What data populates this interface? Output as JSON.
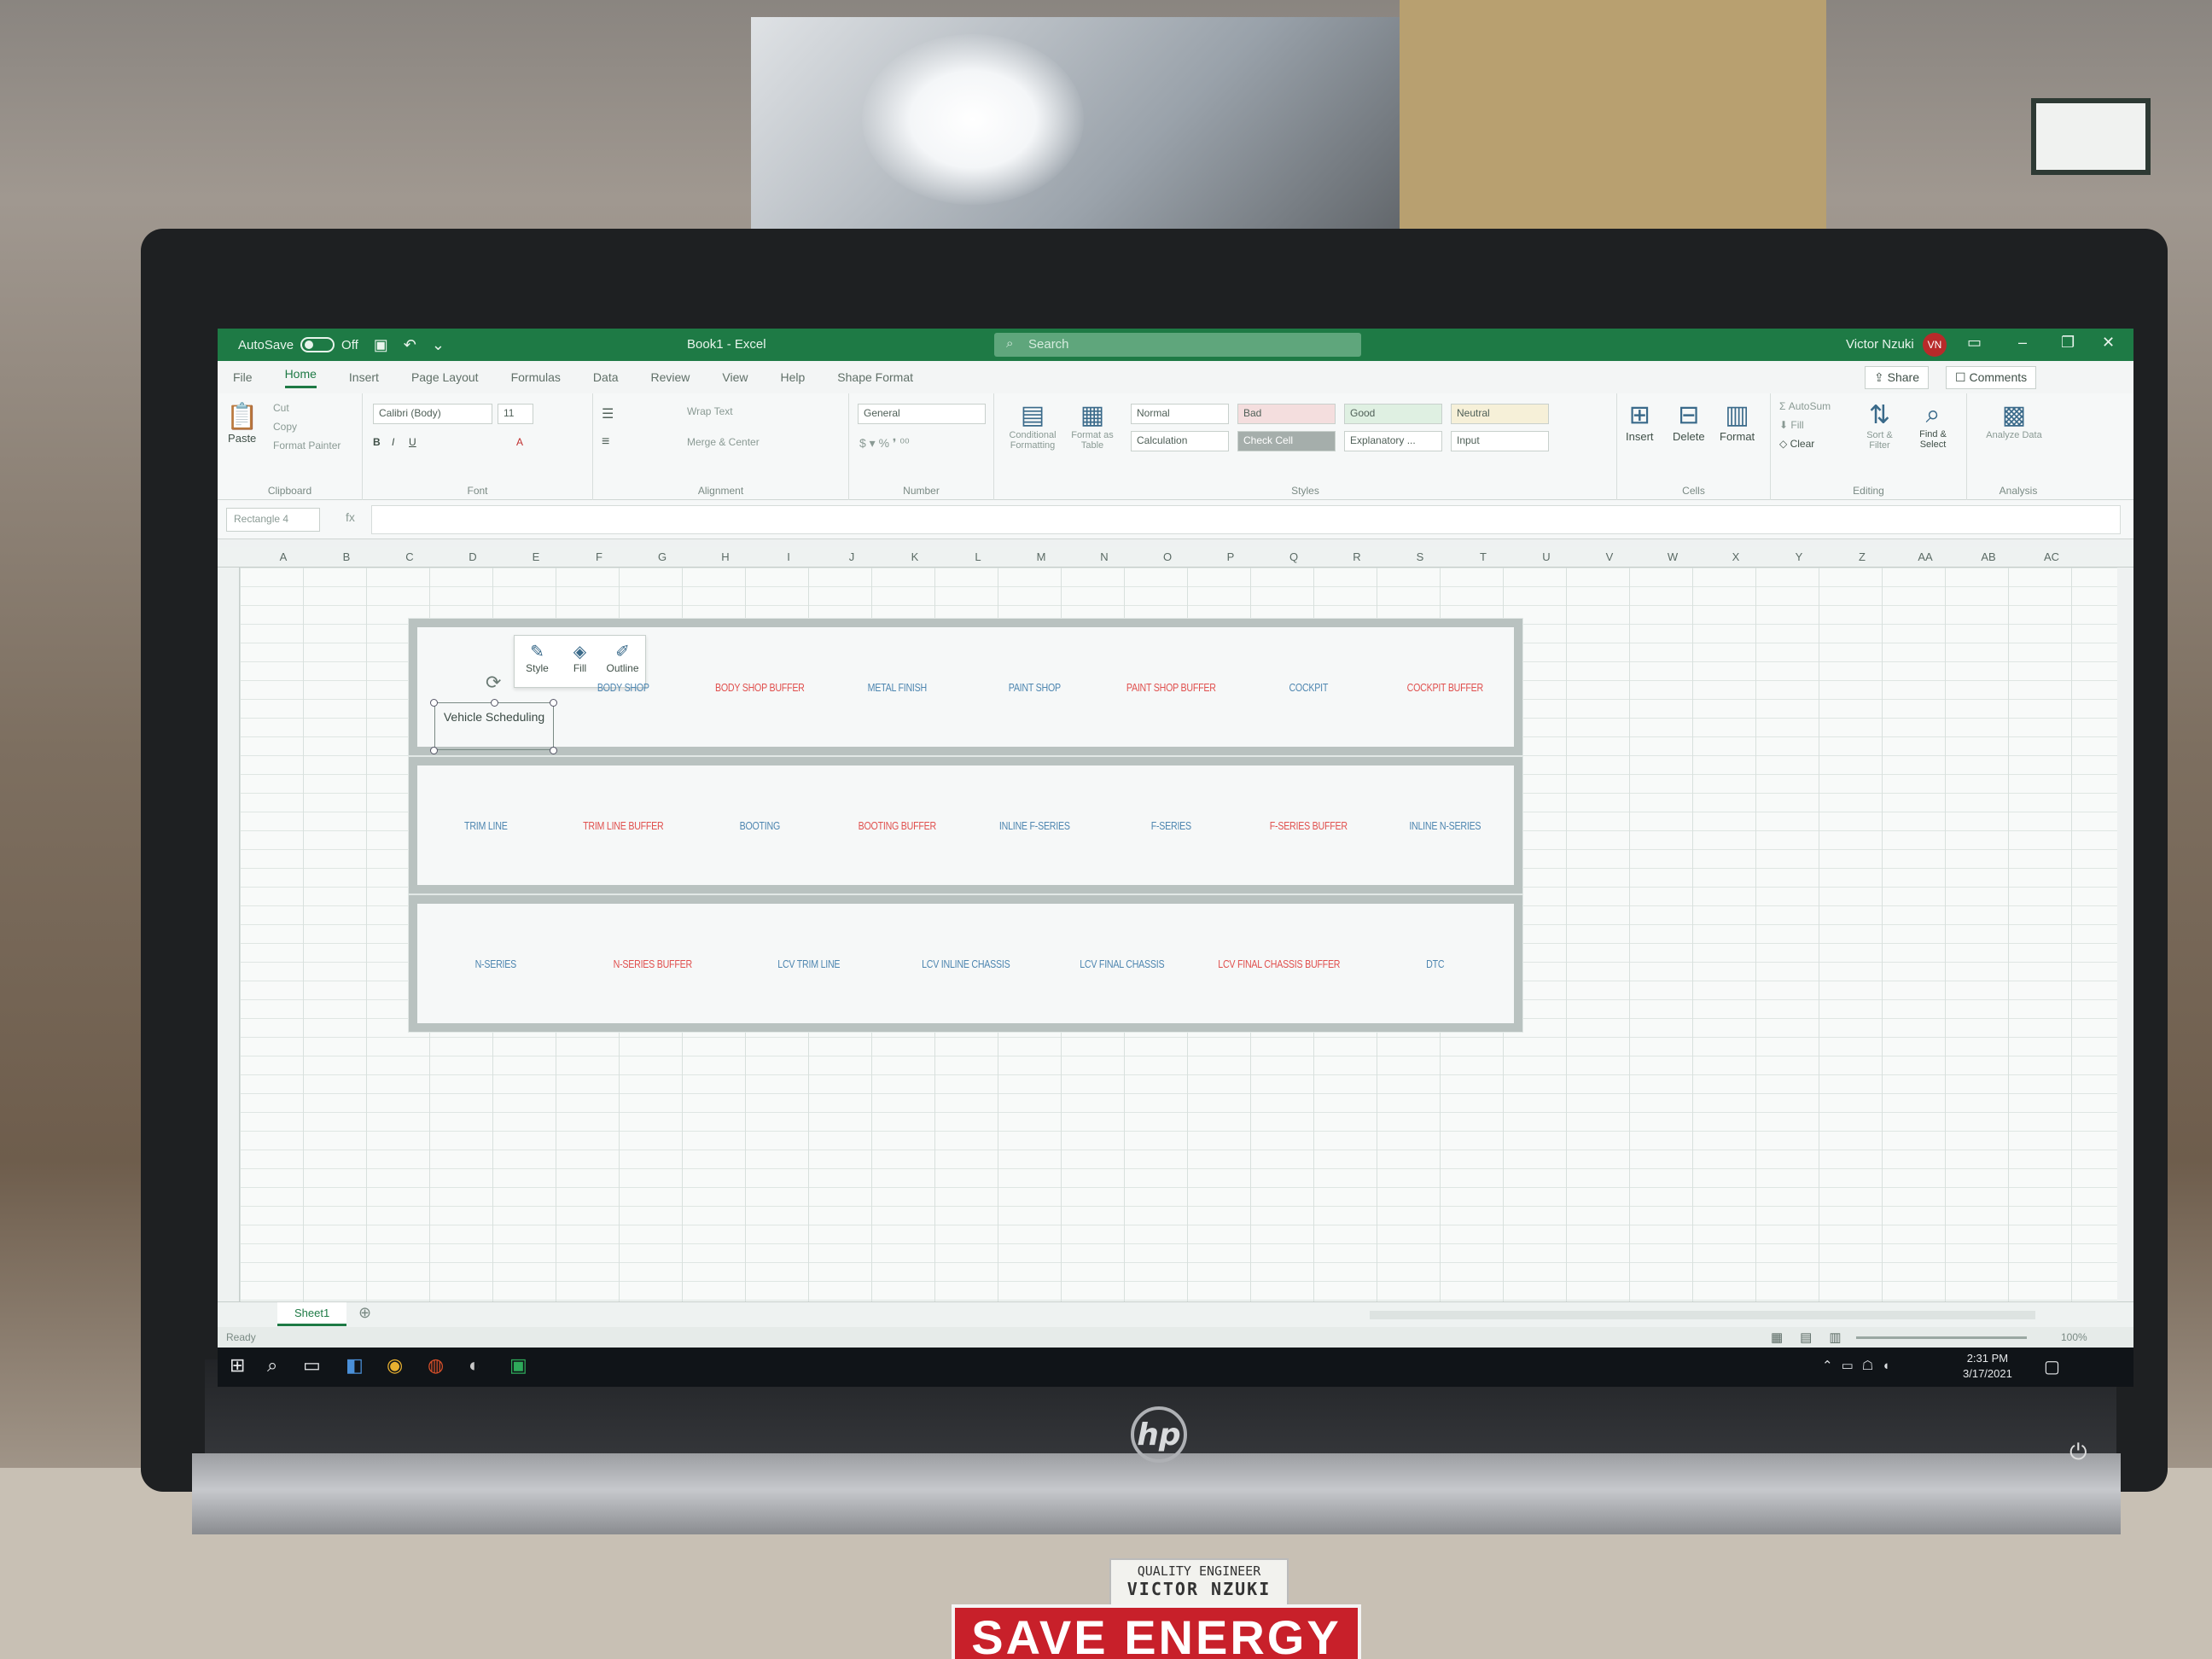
{
  "window": {
    "autosave_label": "AutoSave",
    "autosave_state": "Off",
    "title": "Book1 - Excel",
    "search_placeholder": "Search",
    "user_name": "Victor Nzuki",
    "user_initials": "VN"
  },
  "menu_tabs": [
    "File",
    "Home",
    "Insert",
    "Page Layout",
    "Formulas",
    "Data",
    "Review",
    "View",
    "Help",
    "Shape Format"
  ],
  "active_tab": "Home",
  "share_label": "Share",
  "comments_label": "Comments",
  "ribbon": {
    "clipboard": {
      "paste": "Paste",
      "cut": "Cut",
      "copy": "Copy",
      "format_painter": "Format Painter",
      "label": "Clipboard"
    },
    "font": {
      "font_name": "Calibri (Body)",
      "font_size": "11",
      "label": "Font"
    },
    "alignment": {
      "wrap": "Wrap Text",
      "merge": "Merge & Center",
      "label": "Alignment"
    },
    "number": {
      "format": "General",
      "label": "Number"
    },
    "styles": {
      "conditional": "Conditional Formatting",
      "format_table": "Format as Table",
      "cells": [
        "Normal",
        "Bad",
        "Good",
        "Neutral",
        "Calculation",
        "Check Cell",
        "Explanatory ...",
        "Input"
      ],
      "label": "Styles"
    },
    "cells": {
      "insert": "Insert",
      "delete": "Delete",
      "format": "Format",
      "label": "Cells"
    },
    "editing": {
      "autosum": "AutoSum",
      "fill": "Fill",
      "clear": "Clear",
      "sort": "Sort & Filter",
      "find": "Find & Select",
      "label": "Editing"
    },
    "analysis": {
      "analyze": "Analyze Data",
      "label": "Analysis"
    }
  },
  "name_box": "Rectangle 4",
  "fx": "fx",
  "columns": [
    "A",
    "B",
    "C",
    "D",
    "E",
    "F",
    "G",
    "H",
    "I",
    "J",
    "K",
    "L",
    "M",
    "N",
    "O",
    "P",
    "Q",
    "R",
    "S",
    "T",
    "U",
    "V",
    "W",
    "X",
    "Y",
    "Z",
    "AA",
    "AB",
    "AC"
  ],
  "mini_toolbar": {
    "style": "Style",
    "fill": "Fill",
    "outline": "Outline"
  },
  "selected_shape_text": "Vehicle Scheduling",
  "rows": [
    [
      {
        "label": "BODY SHOP",
        "type": "normal"
      },
      {
        "label": "BODY SHOP BUFFER",
        "type": "buffer"
      },
      {
        "label": "METAL FINISH",
        "type": "normal"
      },
      {
        "label": "PAINT SHOP",
        "type": "normal"
      },
      {
        "label": "PAINT SHOP BUFFER",
        "type": "buffer"
      },
      {
        "label": "COCKPIT",
        "type": "normal"
      },
      {
        "label": "COCKPIT BUFFER",
        "type": "buffer"
      }
    ],
    [
      {
        "label": "TRIM LINE",
        "type": "normal"
      },
      {
        "label": "TRIM LINE BUFFER",
        "type": "buffer"
      },
      {
        "label": "BOOTING",
        "type": "normal"
      },
      {
        "label": "BOOTING BUFFER",
        "type": "buffer"
      },
      {
        "label": "INLINE F-SERIES",
        "type": "normal"
      },
      {
        "label": "F-SERIES",
        "type": "normal"
      },
      {
        "label": "F-SERIES BUFFER",
        "type": "buffer"
      },
      {
        "label": "INLINE N-SERIES",
        "type": "normal"
      }
    ],
    [
      {
        "label": "N-SERIES",
        "type": "normal"
      },
      {
        "label": "N-SERIES BUFFER",
        "type": "buffer"
      },
      {
        "label": "LCV TRIM LINE",
        "type": "normal"
      },
      {
        "label": "LCV INLINE CHASSIS",
        "type": "normal"
      },
      {
        "label": "LCV FINAL CHASSIS",
        "type": "normal"
      },
      {
        "label": "LCV FINAL CHASSIS BUFFER",
        "type": "buffer"
      },
      {
        "label": "DTC",
        "type": "normal"
      }
    ]
  ],
  "sheet_tab": "Sheet1",
  "status": {
    "ready": "Ready",
    "zoom": "100%"
  },
  "taskbar": {
    "time": "2:31 PM",
    "date": "3/17/2021"
  },
  "monitor": {
    "brand": "hp",
    "nameplate_title": "QUALITY ENGINEER",
    "nameplate_name": "VICTOR NZUKI",
    "sticker": "SAVE ENERGY"
  },
  "colors": {
    "excel_green": "#1e7a45",
    "stage_normal": "#4e86b0",
    "stage_buffer": "#e0504e"
  }
}
